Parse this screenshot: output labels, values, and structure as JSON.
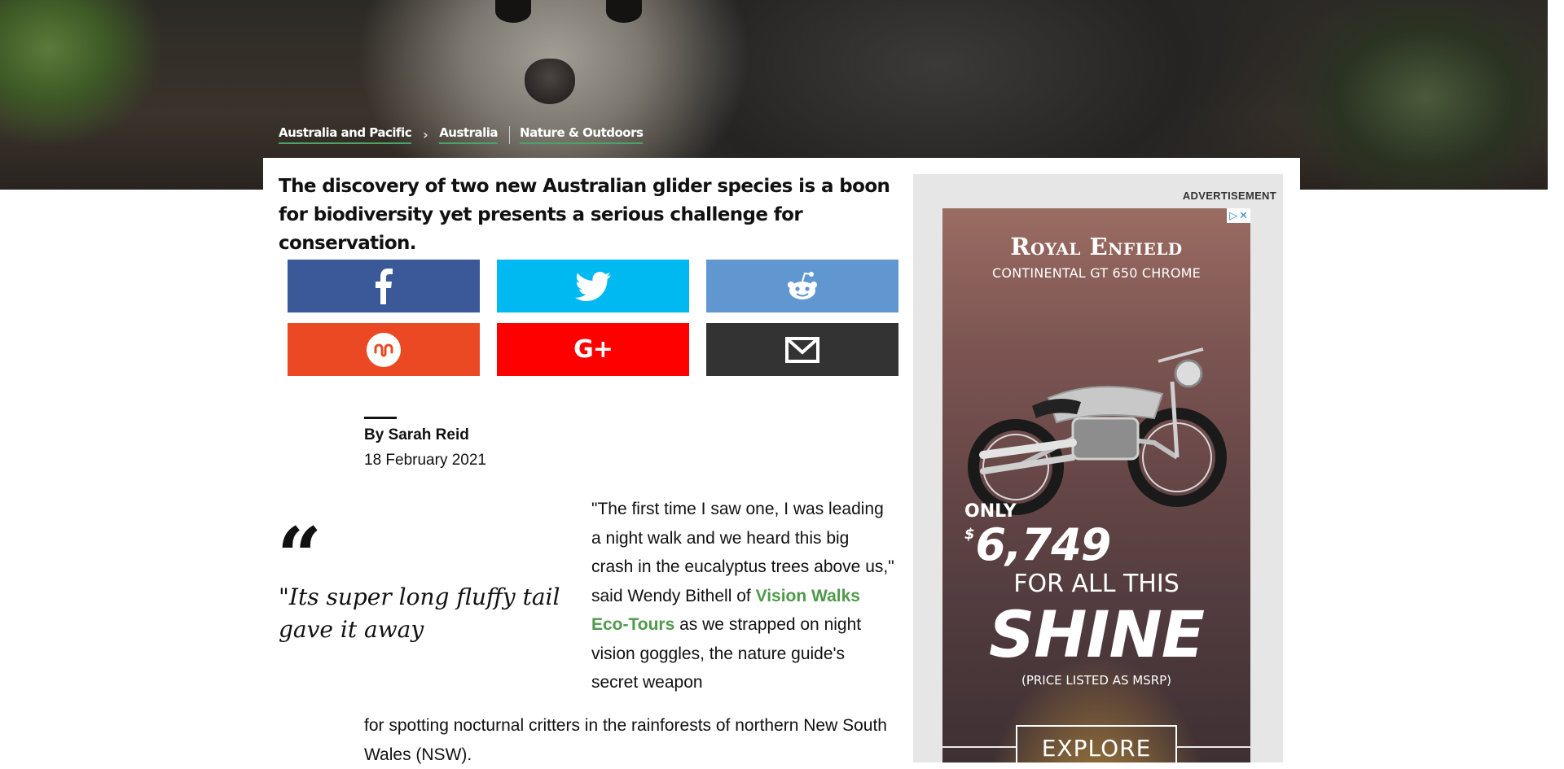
{
  "breadcrumb": {
    "items": [
      "Australia and Pacific",
      "Australia",
      "Nature & Outdoors"
    ]
  },
  "article": {
    "headline": "The discovery of two new Australian glider species is a boon for biodiversity yet presents a serious challenge for conservation.",
    "byline": "By Sarah Reid",
    "date": "18 February 2021",
    "quote_mark": "“",
    "pull_quote": "\"Its super long fluffy tail gave it away",
    "body_part1": "\"The first time I saw one, I was leading a night walk and we heard this big crash in the eucalyptus trees above us,\" said Wendy Bithell of ",
    "body_link": "Vision Walks Eco-Tours",
    "body_part2": " as we strapped on night vision goggles, the nature guide's secret weapon",
    "body_part3": "for spotting nocturnal critters in the rainforests of northern New South Wales (NSW)."
  },
  "share": {
    "buttons": [
      {
        "name": "facebook",
        "icon": "facebook-icon",
        "color": "#3b5998"
      },
      {
        "name": "twitter",
        "icon": "twitter-icon",
        "color": "#00b9f0"
      },
      {
        "name": "reddit",
        "icon": "reddit-icon",
        "color": "#6097d0"
      },
      {
        "name": "stumbleupon",
        "icon": "stumbleupon-icon",
        "color": "#eb4924"
      },
      {
        "name": "google-plus",
        "icon": "google-plus-icon",
        "color": "#ff0000"
      },
      {
        "name": "email",
        "icon": "email-icon",
        "color": "#333333"
      }
    ],
    "google_plus_text": "G+"
  },
  "ad": {
    "label": "ADVERTISEMENT",
    "choices_i": "▷",
    "choices_x": "✕",
    "brand": "Royal Enfield",
    "model": "CONTINENTAL GT 650 CHROME",
    "only": "ONLY",
    "price_symbol": "$",
    "price": "6,749",
    "for_all": "FOR ALL THIS",
    "shine": "SHINE",
    "msrp": "(PRICE LISTED AS MSRP)",
    "cta": "EXPLORE"
  },
  "colors": {
    "link_green": "#4f9a4a",
    "breadcrumb_underline": "#4aa564"
  }
}
